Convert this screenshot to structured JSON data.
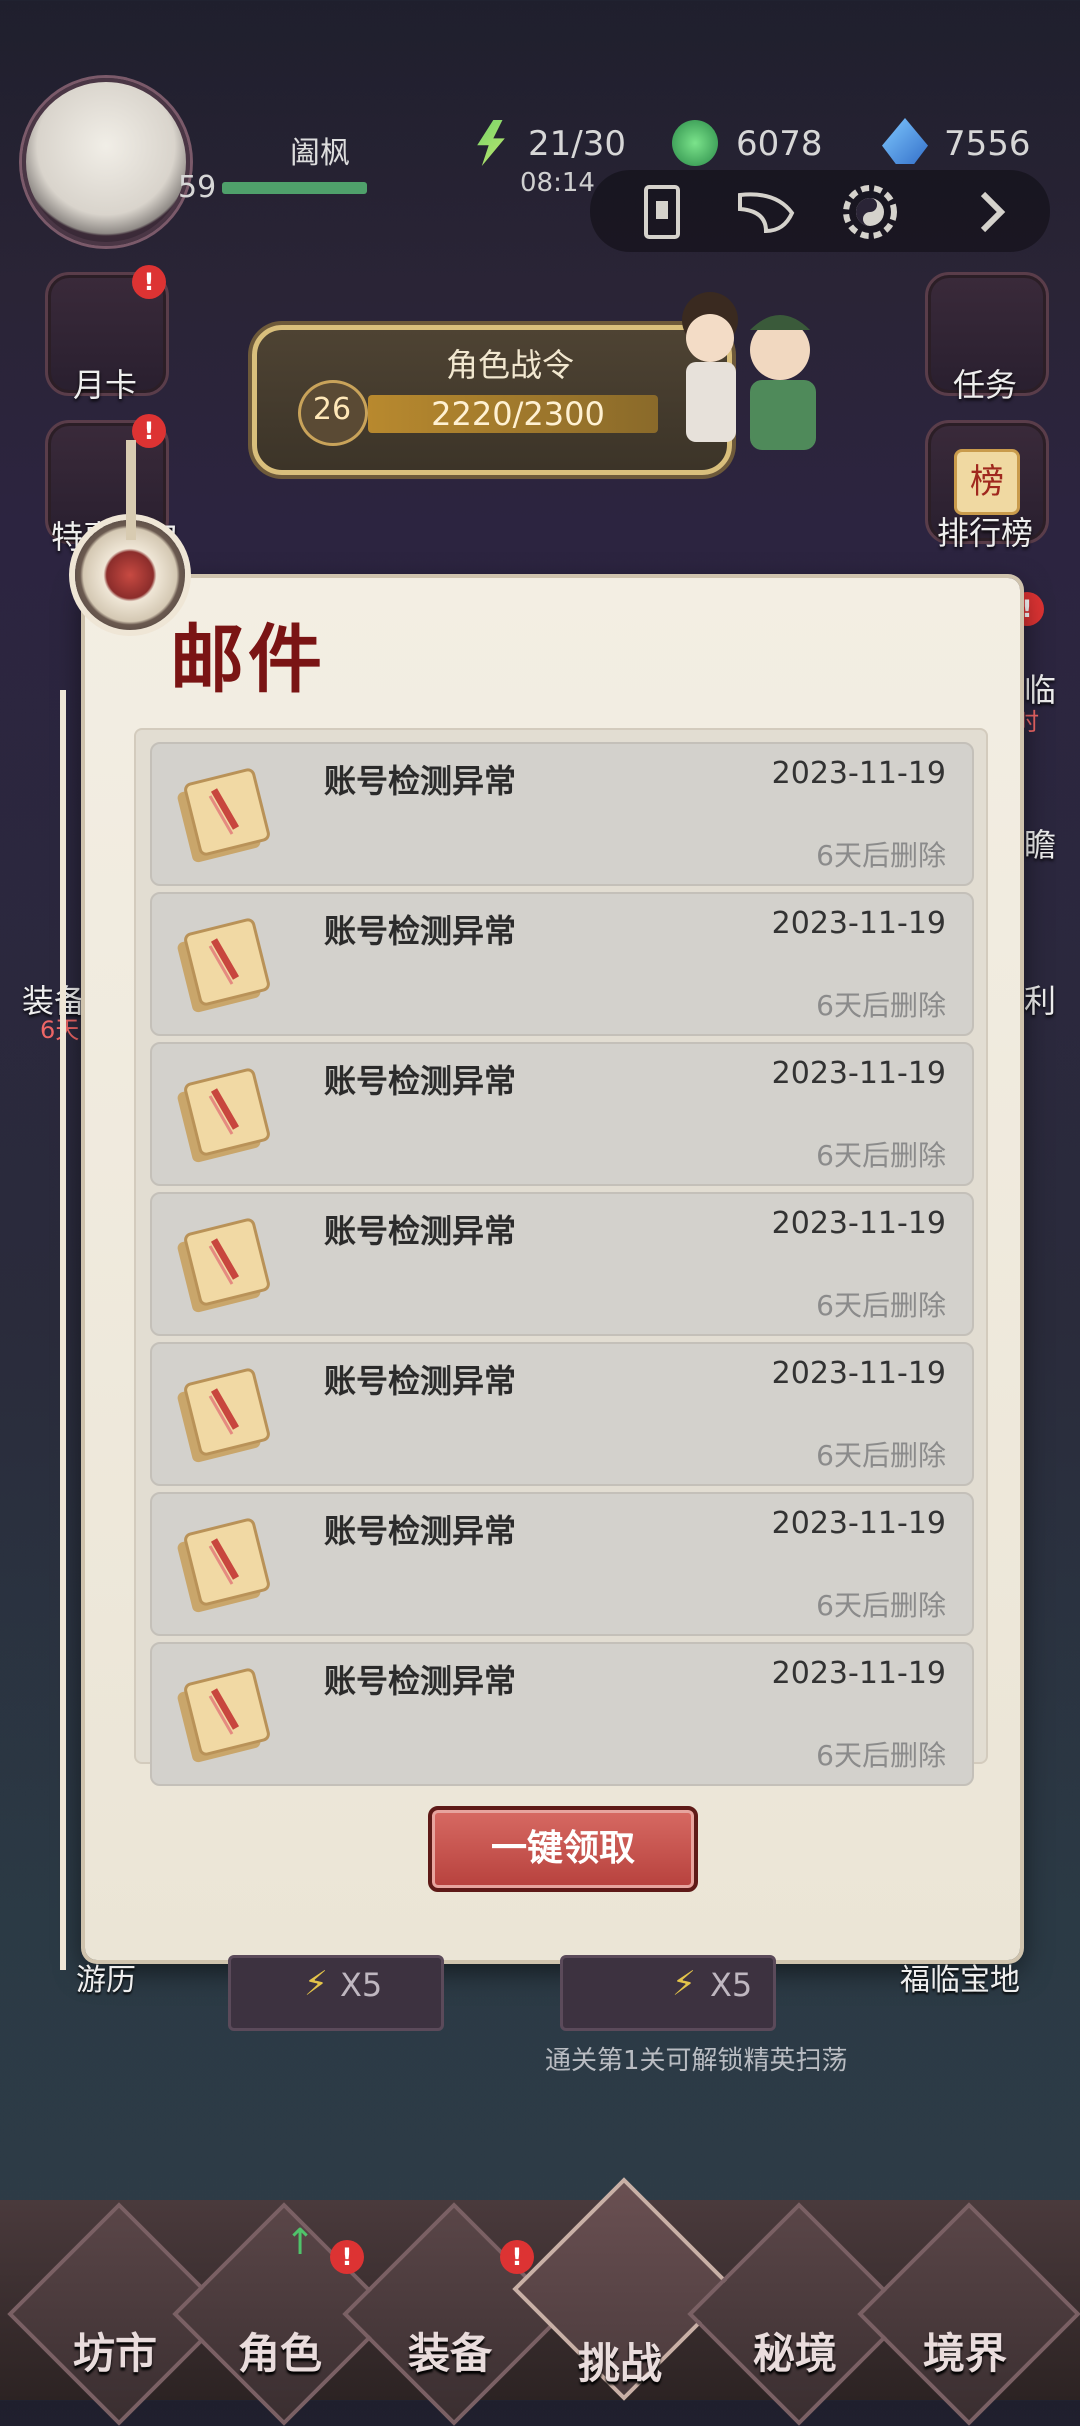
{
  "player": {
    "name": "阖枫",
    "level": "59",
    "exp_fraction": 1.0
  },
  "resources": {
    "stamina": "21/30",
    "stamina_timer": "08:14",
    "jade": "6078",
    "ink": "7556"
  },
  "toolbar": {
    "icons": [
      "scroll-icon",
      "horn-icon",
      "yin-yang-gear-icon",
      "chevron-right-icon"
    ]
  },
  "side_left": {
    "monthly_card": "月卡",
    "special_gift": "特惠礼包",
    "equipment": "装备",
    "equipment_timer": "6天",
    "travel": "游历"
  },
  "side_right": {
    "task": "任务",
    "ranking": "排行榜",
    "ranking_badge": "榜",
    "approach": "临",
    "approach_timer": "时",
    "gaze": "瞻",
    "welfare": "利",
    "blessed_land": "福临宝地"
  },
  "battle_pass": {
    "title": "角色战令",
    "level": "26",
    "progress": "2220/2300",
    "progress_fraction": 0.965
  },
  "mail": {
    "title": "邮件",
    "items": [
      {
        "subject": "账号检测异常",
        "date": "2023-11-19",
        "expire": "6天后删除"
      },
      {
        "subject": "账号检测异常",
        "date": "2023-11-19",
        "expire": "6天后删除"
      },
      {
        "subject": "账号检测异常",
        "date": "2023-11-19",
        "expire": "6天后删除"
      },
      {
        "subject": "账号检测异常",
        "date": "2023-11-19",
        "expire": "6天后删除"
      },
      {
        "subject": "账号检测异常",
        "date": "2023-11-19",
        "expire": "6天后删除"
      },
      {
        "subject": "账号检测异常",
        "date": "2023-11-19",
        "expire": "6天后删除"
      },
      {
        "subject": "账号检测异常",
        "date": "2023-11-19",
        "expire": "6天后删除"
      }
    ],
    "claim_all": "一键领取"
  },
  "sweep": {
    "cost_left": "X5",
    "cost_right": "X5",
    "hint": "通关第1关可解锁精英扫荡"
  },
  "nav": {
    "items": [
      "坊市",
      "角色",
      "装备",
      "挑战",
      "秘境",
      "境界"
    ],
    "active": "挑战"
  },
  "colors": {
    "accent_red": "#b7413d",
    "title_red": "#7a1414",
    "badge_red": "#d33"
  }
}
